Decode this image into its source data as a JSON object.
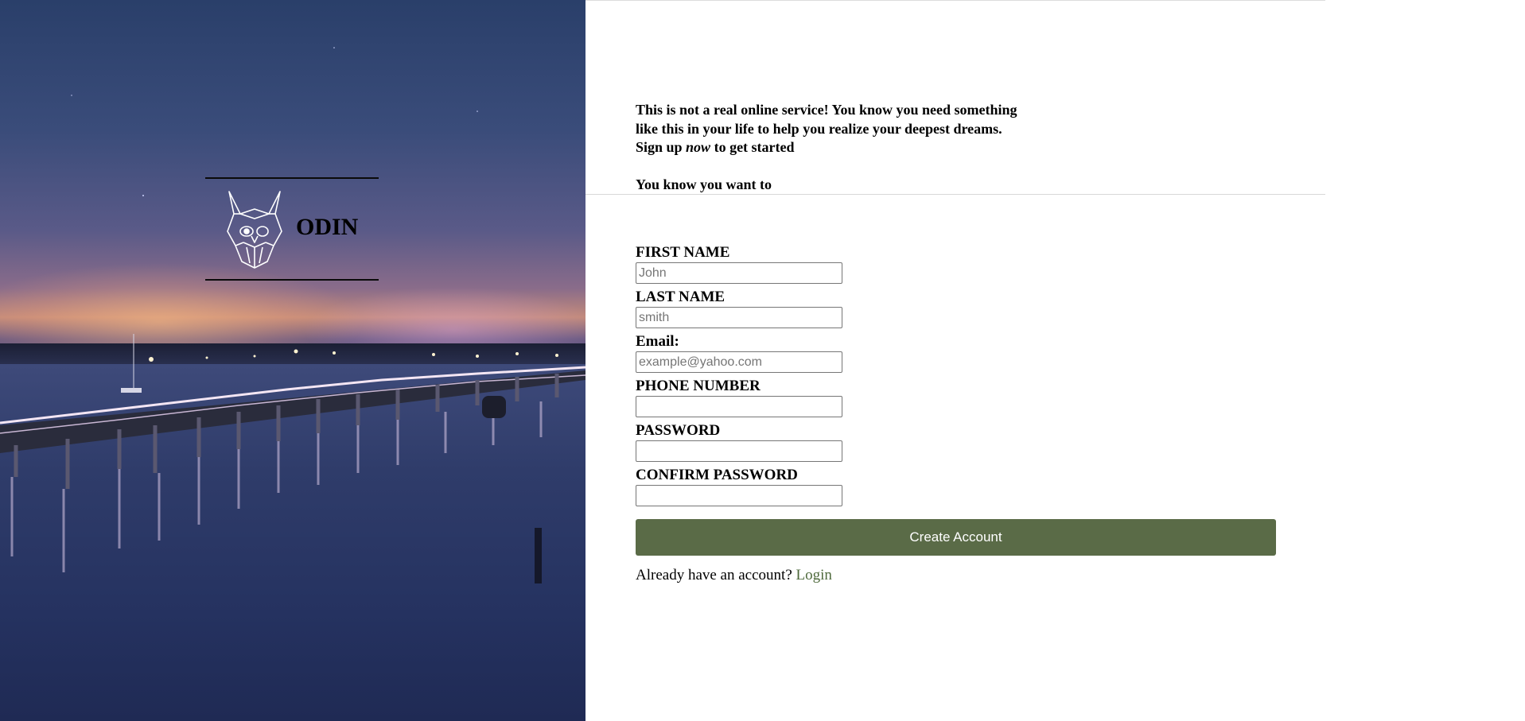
{
  "brand": {
    "name": "ODIN",
    "logo_icon": "viking-helmet-icon"
  },
  "intro": {
    "line1": "This is not a real online service! You know you need something",
    "line2": "like this in your life to help you realize your deepest dreams.",
    "line3_prefix": "Sign up ",
    "line3_emphasis": "now",
    "line3_suffix": " to get started",
    "line4": "You know you want to"
  },
  "form": {
    "first_name": {
      "label": "FIRST NAME",
      "placeholder": "John",
      "value": ""
    },
    "last_name": {
      "label": "LAST NAME",
      "placeholder": "smith",
      "value": ""
    },
    "email": {
      "label": "Email:",
      "placeholder": "example@yahoo.com",
      "value": ""
    },
    "phone": {
      "label": "PHONE NUMBER",
      "placeholder": "",
      "value": ""
    },
    "password": {
      "label": "PASSWORD",
      "placeholder": "",
      "value": ""
    },
    "confirm_password": {
      "label": "CONFIRM PASSWORD",
      "placeholder": "",
      "value": ""
    },
    "submit_label": "Create Account"
  },
  "footer": {
    "prompt": "Already have an account?",
    "login_label": "Login"
  },
  "colors": {
    "button_bg": "#5a6b47",
    "link": "#4f6a3c"
  }
}
